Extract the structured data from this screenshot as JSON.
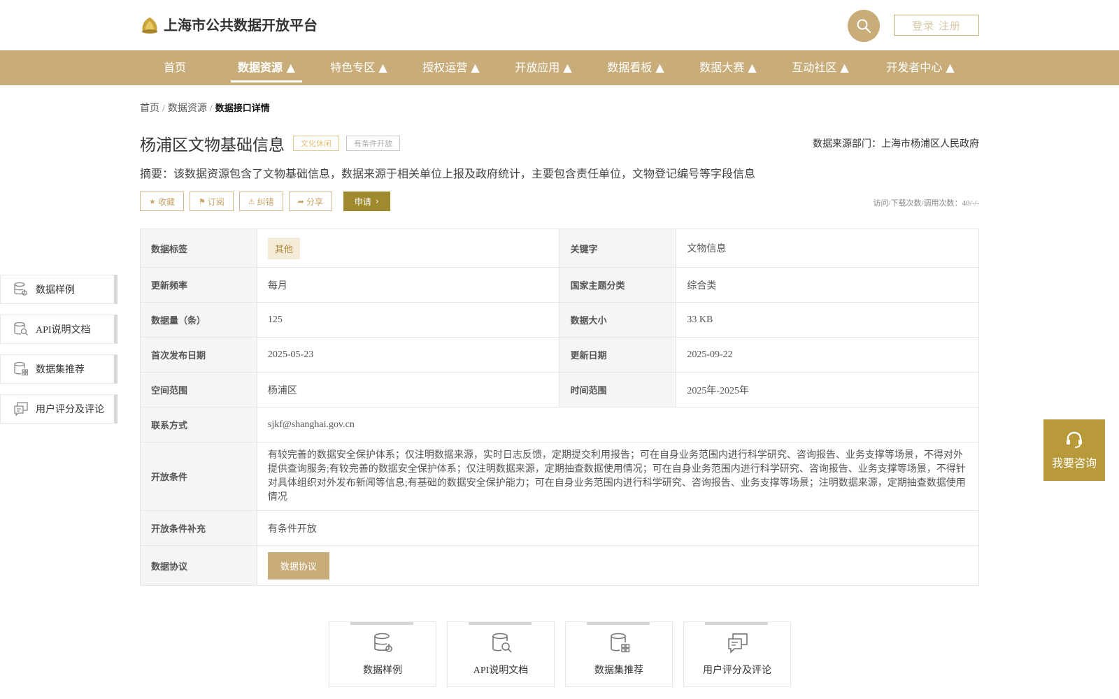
{
  "header": {
    "site_title": "上海市公共数据开放平台",
    "login_label": "登录 注册"
  },
  "nav": {
    "items": [
      {
        "label": "首页"
      },
      {
        "label": "数据资源 ▲"
      },
      {
        "label": "特色专区 ▲"
      },
      {
        "label": "授权运营 ▲"
      },
      {
        "label": "开放应用 ▲"
      },
      {
        "label": "数据看板 ▲"
      },
      {
        "label": "数据大赛 ▲"
      },
      {
        "label": "互动社区 ▲"
      },
      {
        "label": "开发者中心 ▲"
      }
    ],
    "active_index": 1
  },
  "breadcrumb": {
    "home": "首页",
    "section": "数据资源",
    "current": "数据接口详情",
    "separator": "/"
  },
  "detail": {
    "title": "杨浦区文物基础信息",
    "tag_category": "文化休闲",
    "tag_open_type": "有条件开放",
    "source_dept": "数据来源部门：上海市杨浦区人民政府",
    "summary": "摘要：该数据资源包含了文物基础信息，数据来源于相关单位上报及政府统计，主要包含责任单位，文物登记编号等字段信息",
    "visit_count": "访问/下载次数/调用次数：40/-/-"
  },
  "actions": {
    "favorite": "收藏",
    "subscribe": "订阅",
    "report": "纠错",
    "share": "分享",
    "apply": "申请"
  },
  "table": {
    "data_tag_label": "数据标签",
    "data_tag_value": "其他",
    "keyword_label": "关键字",
    "keyword_value": "文物信息",
    "update_freq_label": "更新频率",
    "update_freq_value": "每月",
    "national_topic_label": "国家主题分类",
    "national_topic_value": "综合类",
    "record_count_label": "数据量（条）",
    "record_count_value": "125",
    "data_size_label": "数据大小",
    "data_size_value": "33 KB",
    "first_publish_label": "首次发布日期",
    "first_publish_value": "2025-05-23",
    "update_date_label": "更新日期",
    "update_date_value": "2025-09-22",
    "spatial_label": "空间范围",
    "spatial_value": "杨浦区",
    "time_range_label": "时间范围",
    "time_range_value": "2025年-2025年",
    "contact_label": "联系方式",
    "contact_value": "sjkf@shanghai.gov.cn",
    "open_cond_label": "开放条件",
    "open_cond_value": "有较完善的数据安全保护体系；仅注明数据来源，实时日志反馈，定期提交利用报告；可在自身业务范围内进行科学研究、咨询报告、业务支撑等场景，不得对外提供查询服务;有较完善的数据安全保护体系；仅注明数据来源，定期抽查数据使用情况；可在自身业务范围内进行科学研究、咨询报告、业务支撑等场景，不得针对具体组织对外发布新闻等信息;有基础的数据安全保护能力；可在自身业务范围内进行科学研究、咨询报告、业务支撑等场景；注明数据来源，定期抽查数据使用情况",
    "open_cond_extra_label": "开放条件补充",
    "open_cond_extra_value": "有条件开放",
    "protocol_label": "数据协议",
    "protocol_button": "数据协议"
  },
  "side_menu": {
    "items": [
      {
        "label": "数据样例",
        "icon": "database-gear-icon"
      },
      {
        "label": "API说明文档",
        "icon": "database-search-icon"
      },
      {
        "label": "数据集推荐",
        "icon": "database-grid-icon"
      },
      {
        "label": "用户评分及评论",
        "icon": "comment-icon"
      }
    ]
  },
  "consult": {
    "label": "我要咨询",
    "icon": "headset-icon"
  },
  "colors": {
    "brand": "#c8ad7a",
    "apply": "#a08a2e",
    "consult": "#b89a3a"
  }
}
